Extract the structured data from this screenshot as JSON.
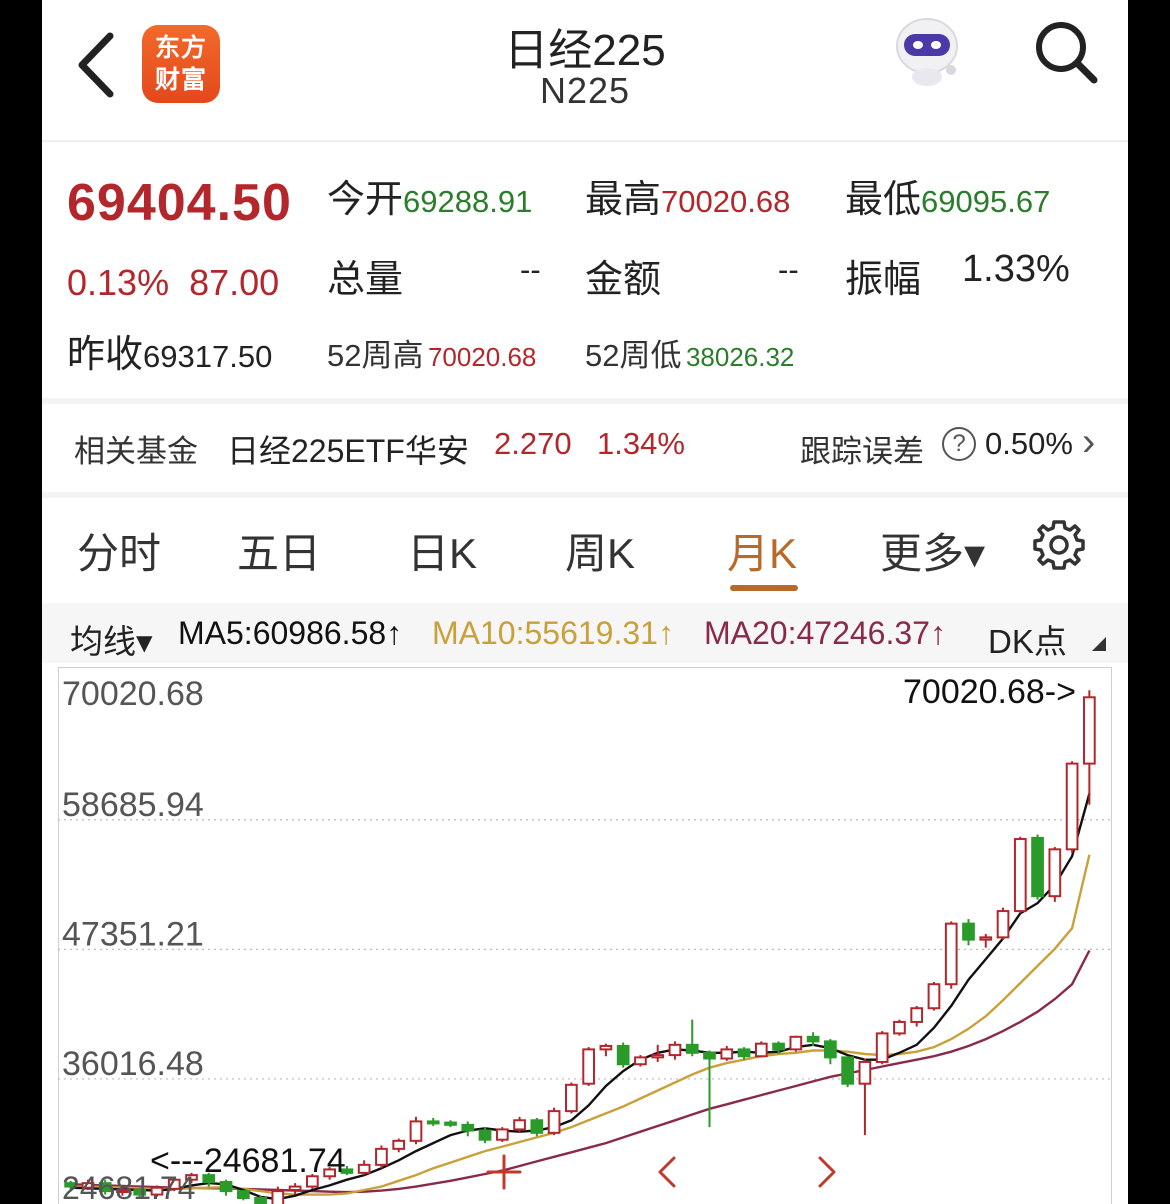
{
  "header": {
    "logo_text": [
      "东方",
      "财富"
    ],
    "title": "日经225",
    "subtitle": "N225"
  },
  "quote": {
    "price": "69404.50",
    "change_pct": "0.13%",
    "change_val": "87.00",
    "open_label": "今开",
    "open": "69288.91",
    "high_label": "最高",
    "high": "70020.68",
    "low_label": "最低",
    "low": "69095.67",
    "volume_label": "总量",
    "volume": "--",
    "amount_label": "金额",
    "amount": "--",
    "amplitude_label": "振幅",
    "amplitude": "1.33%",
    "prev_close_label": "昨收",
    "prev_close": "69317.50",
    "w52_high_label": "52周高",
    "w52_high": "70020.68",
    "w52_low_label": "52周低",
    "w52_low": "38026.32"
  },
  "fund": {
    "label": "相关基金",
    "name": "日经225ETF华安",
    "price": "2.270",
    "pct": "1.34%",
    "tracking_label": "跟踪误差",
    "tracking_help": "?",
    "tracking_value": "0.50%",
    "chevron": "›"
  },
  "tabs": [
    {
      "label": "分时"
    },
    {
      "label": "五日"
    },
    {
      "label": "日K"
    },
    {
      "label": "周K"
    },
    {
      "label": "月K",
      "active": true
    },
    {
      "label": "更多▾"
    }
  ],
  "ma_bar": {
    "selector": "均线▾",
    "ma5": "MA5:60986.58↑",
    "ma10": "MA10:55619.31↑",
    "ma20": "MA20:47246.37↑",
    "dk": "DK点"
  },
  "colors": {
    "up": "#b3262b",
    "down": "#2a9b2a",
    "accent": "#b86a2a",
    "ma5": "#111111",
    "ma10": "#c9a03a",
    "ma20": "#8a2a4a"
  },
  "chart_data": {
    "type": "candlestick",
    "y_ticks": [
      "70020.68",
      "58685.94",
      "47351.21",
      "36016.48"
    ],
    "ylim": [
      24200,
      70300
    ],
    "max_label": "70020.68->",
    "min_label": "<---24681.74",
    "min_label_bottom": "24681.74",
    "candles": [
      [
        26900,
        26600,
        27100,
        26300
      ],
      [
        26500,
        26900,
        27200,
        26300
      ],
      [
        26900,
        26200,
        27200,
        25900
      ],
      [
        26200,
        26300,
        26700,
        25800
      ],
      [
        26300,
        25900,
        26500,
        25600
      ],
      [
        25900,
        26500,
        26700,
        25700
      ],
      [
        26400,
        27200,
        27400,
        26200
      ],
      [
        27200,
        27600,
        27800,
        26900
      ],
      [
        27600,
        27000,
        27800,
        26600
      ],
      [
        27000,
        26200,
        27200,
        25800
      ],
      [
        26200,
        25600,
        26300,
        25400
      ],
      [
        25600,
        24900,
        25800,
        24681.74
      ],
      [
        24900,
        26200,
        26600,
        24700
      ],
      [
        26300,
        26600,
        26900,
        25900
      ],
      [
        26600,
        27500,
        27700,
        26400
      ],
      [
        27500,
        28100,
        28300,
        27200
      ],
      [
        28100,
        27800,
        28400,
        27600
      ],
      [
        27800,
        28500,
        28900,
        27600
      ],
      [
        28500,
        29900,
        30200,
        28200
      ],
      [
        29900,
        30600,
        30800,
        29600
      ],
      [
        30600,
        32300,
        32700,
        30300
      ],
      [
        32300,
        32200,
        32600,
        31900
      ],
      [
        32200,
        32000,
        32400,
        31800
      ],
      [
        32000,
        31500,
        32300,
        31000
      ],
      [
        31500,
        30700,
        31800,
        30400
      ],
      [
        30700,
        31600,
        31800,
        30500
      ],
      [
        31600,
        32400,
        32700,
        31300
      ],
      [
        32400,
        31300,
        32600,
        31000
      ],
      [
        31300,
        33200,
        33500,
        31100
      ],
      [
        33200,
        35500,
        35700,
        33000
      ],
      [
        35600,
        38600,
        38800,
        35400
      ],
      [
        38600,
        38900,
        39100,
        38000
      ],
      [
        38900,
        37300,
        39200,
        37000
      ],
      [
        37300,
        37900,
        38100,
        37100
      ],
      [
        37900,
        38100,
        39000,
        37500
      ],
      [
        38100,
        39000,
        39300,
        37700
      ],
      [
        39000,
        38300,
        41200,
        38000
      ],
      [
        38300,
        37800,
        38500,
        31800
      ],
      [
        37800,
        38600,
        38900,
        37600
      ],
      [
        38600,
        38000,
        38800,
        37700
      ],
      [
        38000,
        39100,
        39300,
        37900
      ],
      [
        39100,
        38600,
        39300,
        38200
      ],
      [
        38600,
        39700,
        39800,
        38400
      ],
      [
        39700,
        39300,
        40100,
        38900
      ],
      [
        39300,
        37900,
        39500,
        37300
      ],
      [
        37900,
        35600,
        38000,
        35300
      ],
      [
        35600,
        37500,
        37800,
        31100
      ],
      [
        37500,
        40000,
        40200,
        37300
      ],
      [
        40000,
        41000,
        41200,
        39800
      ],
      [
        41000,
        42200,
        42400,
        40600
      ],
      [
        42200,
        44300,
        44500,
        42000
      ],
      [
        44300,
        49600,
        49800,
        43900
      ],
      [
        49600,
        48200,
        50000,
        47700
      ],
      [
        48200,
        48400,
        48700,
        47500
      ],
      [
        48400,
        50700,
        51000,
        48200
      ],
      [
        50700,
        57000,
        57200,
        50500
      ],
      [
        57100,
        52000,
        57400,
        51700
      ],
      [
        52000,
        56100,
        56300,
        51500
      ],
      [
        56100,
        63600,
        63800,
        55800
      ],
      [
        63600,
        69400,
        70020.68,
        60000
      ]
    ],
    "ma5": [
      26500,
      26450,
      26400,
      26350,
      26300,
      26250,
      26380,
      26700,
      26900,
      26800,
      26300,
      25700,
      25500,
      25800,
      26300,
      26700,
      27200,
      27600,
      28200,
      28900,
      29700,
      30400,
      31100,
      31500,
      31700,
      31500,
      31400,
      31500,
      31800,
      32400,
      33700,
      35400,
      36700,
      37700,
      38300,
      38600,
      38500,
      38300,
      38300,
      38400,
      38300,
      38400,
      38800,
      39000,
      38700,
      38100,
      37700,
      37700,
      38300,
      39000,
      40500,
      42400,
      44700,
      46500,
      48300,
      50500,
      51400,
      53000,
      55500,
      60986.58
    ],
    "ma10": [
      26600,
      26600,
      26550,
      26500,
      26450,
      26400,
      26400,
      26450,
      26500,
      26550,
      26400,
      26200,
      26000,
      25900,
      25900,
      25900,
      26000,
      26300,
      26600,
      27100,
      27600,
      28200,
      28700,
      29200,
      29700,
      30100,
      30500,
      30900,
      31300,
      31800,
      32400,
      33000,
      33600,
      34300,
      35000,
      35700,
      36400,
      37000,
      37400,
      37700,
      38000,
      38200,
      38300,
      38500,
      38500,
      38400,
      38200,
      38100,
      38200,
      38400,
      38800,
      39500,
      40400,
      41500,
      42900,
      44400,
      45900,
      47400,
      49200,
      55619.31
    ],
    "ma20": [
      26800,
      26750,
      26700,
      26650,
      26600,
      26550,
      26500,
      26480,
      26460,
      26440,
      26400,
      26350,
      26300,
      26250,
      26200,
      26150,
      26120,
      26150,
      26250,
      26400,
      26600,
      26850,
      27100,
      27400,
      27700,
      28000,
      28400,
      28800,
      29200,
      29600,
      30000,
      30400,
      30900,
      31400,
      31900,
      32400,
      32900,
      33400,
      33800,
      34200,
      34600,
      35000,
      35400,
      35800,
      36200,
      36500,
      36800,
      37100,
      37400,
      37700,
      38000,
      38400,
      38900,
      39500,
      40200,
      41000,
      41900,
      43000,
      44300,
      47246.37
    ],
    "nav_icons": [
      "plus-icon",
      "chevron-left-icon",
      "chevron-right-icon"
    ]
  }
}
